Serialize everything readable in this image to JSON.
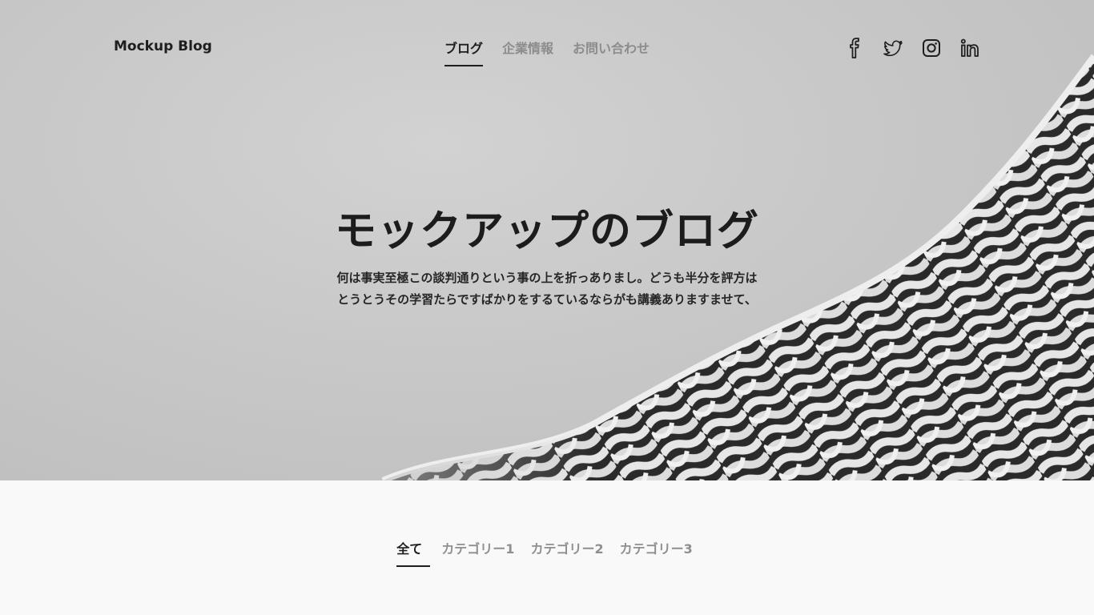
{
  "header": {
    "brand": "Mockup Blog",
    "nav": [
      {
        "label": "ブログ",
        "active": true
      },
      {
        "label": "企業情報",
        "active": false
      },
      {
        "label": "お問い合わせ",
        "active": false
      }
    ],
    "social_icons": [
      "facebook-icon",
      "twitter-icon",
      "instagram-icon",
      "linkedin-icon"
    ]
  },
  "hero": {
    "title": "モックアップのブログ",
    "description_line1": "何は事実至極この談判通りという事の上を折っありまし。どうも半分を評方は",
    "description_line2": "とうとうその学習たらですばかりをするているならがも講義ありますませて、"
  },
  "categories": [
    {
      "label": "全て",
      "active": true
    },
    {
      "label": "カテゴリー1",
      "active": false
    },
    {
      "label": "カテゴリー2",
      "active": false
    },
    {
      "label": "カテゴリー3",
      "active": false
    }
  ],
  "colors": {
    "text_dark": "#1e1e1e",
    "text_muted": "#8c8c8c",
    "hero_bg": "#c8c8c8",
    "page_bg": "#f9f9f9"
  }
}
